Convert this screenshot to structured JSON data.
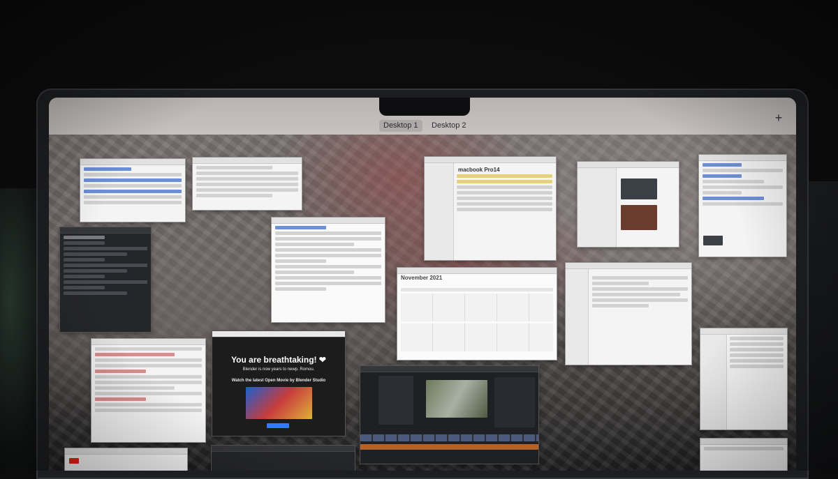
{
  "mission_control": {
    "desktops": [
      "Desktop 1",
      "Desktop 2"
    ],
    "active_desktop": "Desktop 1",
    "add_space_label": "+"
  },
  "windows": {
    "file_manager_title": "macbook Pro14",
    "calendar_title": "November 2021",
    "blender_headline": "You are breathtaking! ❤",
    "blender_subline": "Blender is now years to newp. Romou.",
    "blender_cta": "Watch the latest Open Movie by Blender Studio"
  },
  "colors": {
    "accent_blue": "#2f7cf6",
    "blender_bg": "#1c1c1c",
    "youtube_red": "#e62117"
  }
}
